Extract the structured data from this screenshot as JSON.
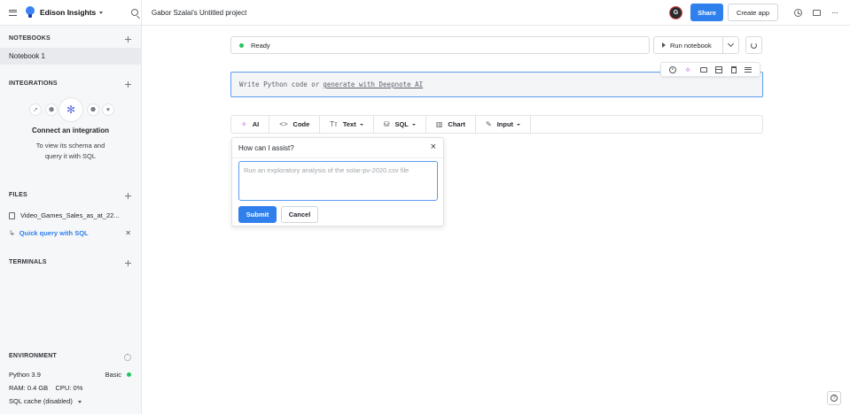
{
  "topbar": {
    "workspace": "Edison Insights",
    "project_title": "Gabor Szalai's Untitled project",
    "avatar_initial": "G",
    "share_label": "Share",
    "create_app_label": "Create app",
    "more_label": "···"
  },
  "sidebar": {
    "notebooks_header": "NOTEBOOKS",
    "notebook_item": "Notebook 1",
    "integrations_header": "INTEGRATIONS",
    "integration_title": "Connect an integration",
    "integration_desc_1": "To view its schema and",
    "integration_desc_2": "query it with SQL",
    "files_header": "FILES",
    "file_name": "Video_Games_Sales_as_at_22...",
    "quick_query": "Quick query with SQL",
    "terminals_header": "TERMINALS",
    "environment_header": "ENVIRONMENT",
    "python_version": "Python 3.9",
    "machine": "Basic",
    "resources": "RAM: 0.4 GB    CPU: 0%",
    "sql_cache": "SQL cache (disabled)"
  },
  "main": {
    "status": "Ready",
    "run_notebook": "Run notebook",
    "code_placeholder_prefix": "Write Python code or",
    "code_placeholder_link": "generate with Deepnote AI",
    "blocks": [
      {
        "icon": "✧",
        "label": "AI"
      },
      {
        "icon": "<>",
        "label": "Code"
      },
      {
        "icon": "Tт",
        "label": "Text"
      },
      {
        "icon": "⛁",
        "label": "SQL"
      },
      {
        "icon": "▥",
        "label": "Chart"
      },
      {
        "icon": "✎",
        "label": "Input"
      }
    ],
    "assist": {
      "title": "How can I assist?",
      "placeholder": "Run an exploratory analysis of the solar-pv-2020.csv file",
      "submit": "Submit",
      "cancel": "Cancel"
    },
    "help": "?"
  },
  "colors": {
    "accent": "#2f80ed",
    "ready": "#22c55e",
    "ai": "#b44fd1"
  }
}
